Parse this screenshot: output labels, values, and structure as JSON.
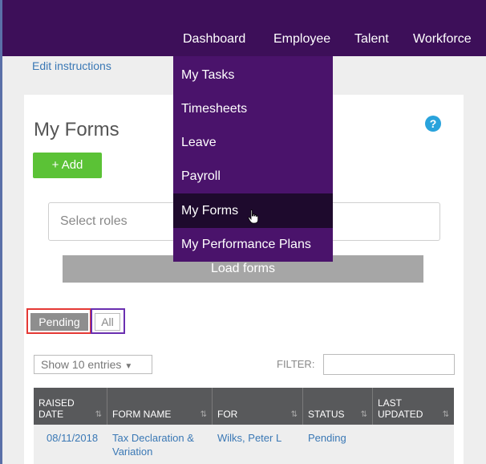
{
  "topnav": {
    "items": [
      "Dashboard",
      "Employee",
      "Talent",
      "Workforce"
    ]
  },
  "edit_instructions": "Edit instructions",
  "page": {
    "title": "My Forms",
    "help_icon": "question-circle-icon",
    "add_label": "+ Add",
    "roles_placeholder": "Select roles",
    "load_forms_label": "Load forms"
  },
  "status_toggle": {
    "pending_label": "Pending",
    "all_label": "All"
  },
  "table_controls": {
    "show_entries": "Show 10 entries",
    "filter_label": "FILTER:"
  },
  "table": {
    "columns": [
      {
        "label_1": "RAISED",
        "label_2": "DATE"
      },
      {
        "label_1": "",
        "label_2": "FORM NAME"
      },
      {
        "label_1": "",
        "label_2": "FOR"
      },
      {
        "label_1": "",
        "label_2": "STATUS"
      },
      {
        "label_1": "LAST",
        "label_2": "UPDATED"
      }
    ],
    "rows": [
      {
        "raised_date": "08/11/2018",
        "form_name_1": "Tax Declaration &",
        "form_name_2": "Variation",
        "for": "Wilks, Peter L",
        "status": "Pending",
        "last_updated": ""
      }
    ]
  },
  "employee_menu": {
    "items": [
      "My Tasks",
      "Timesheets",
      "Leave",
      "Payroll",
      "My Forms",
      "My Performance Plans"
    ],
    "active_item": "My Forms"
  },
  "colors": {
    "topbar": "#3d0f59",
    "menu_bg": "#4a136b",
    "menu_active": "#1e0a2d",
    "add_button": "#5bc236",
    "link": "#3a78b5",
    "highlight_red": "#e53935",
    "highlight_purple": "#6a2fb0"
  }
}
